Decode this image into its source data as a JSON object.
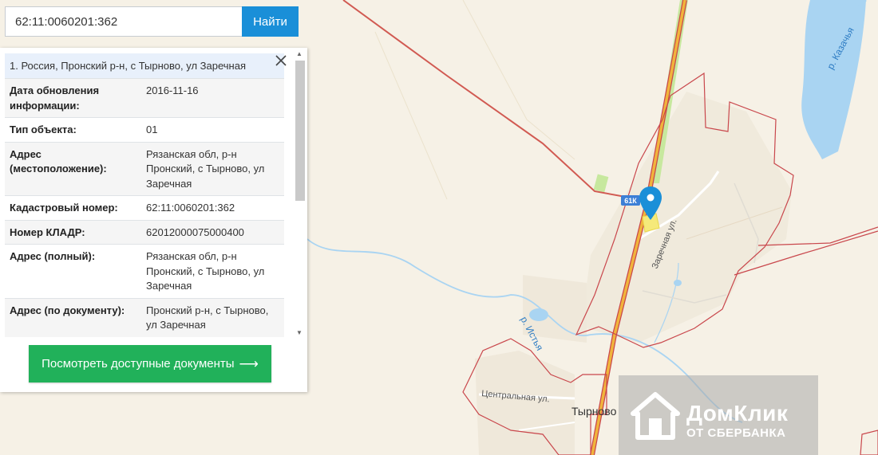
{
  "search": {
    "value": "62:11:0060201:362",
    "button_label": "Найти"
  },
  "result": {
    "title": "1. Россия, Пронский р-н, с Тырново, ул Заречная",
    "rows": [
      {
        "key": "Дата обновления информации:",
        "value": "2016-11-16"
      },
      {
        "key": "Тип объекта:",
        "value": "01"
      },
      {
        "key": "Адрес (местоположение):",
        "value": "Рязанская обл, р-н Пронский, с Тырново, ул Заречная"
      },
      {
        "key": "Кадастровый номер:",
        "value": "62:11:0060201:362"
      },
      {
        "key": "Номер КЛАДР:",
        "value": "62012000075000400"
      },
      {
        "key": "Адрес (полный):",
        "value": "Рязанская обл, р-н Пронский, с Тырново, ул Заречная"
      },
      {
        "key": "Адрес (по документу):",
        "value": "Пронский р-н, с Тырново, ул Заречная"
      }
    ]
  },
  "docs_button": {
    "label": "Посмотреть доступные документы",
    "arrow": "⟶"
  },
  "map": {
    "labels": {
      "river_kazachya": "р. Казачья",
      "river_istya": "р. Истья",
      "road_badge": "61К",
      "street_zarechnaya": "Заречная ул.",
      "street_centralnaya": "Центральная ул.",
      "village": "Тырново"
    },
    "colors": {
      "background": "#f6f1e6",
      "boundary": "#c9474c",
      "road": "#f0b43c",
      "water": "#a9d4f2",
      "marker": "#1a8fd8"
    }
  },
  "watermark": {
    "title": "ДомКлик",
    "subtitle": "ОТ СБЕРБАНКА"
  }
}
